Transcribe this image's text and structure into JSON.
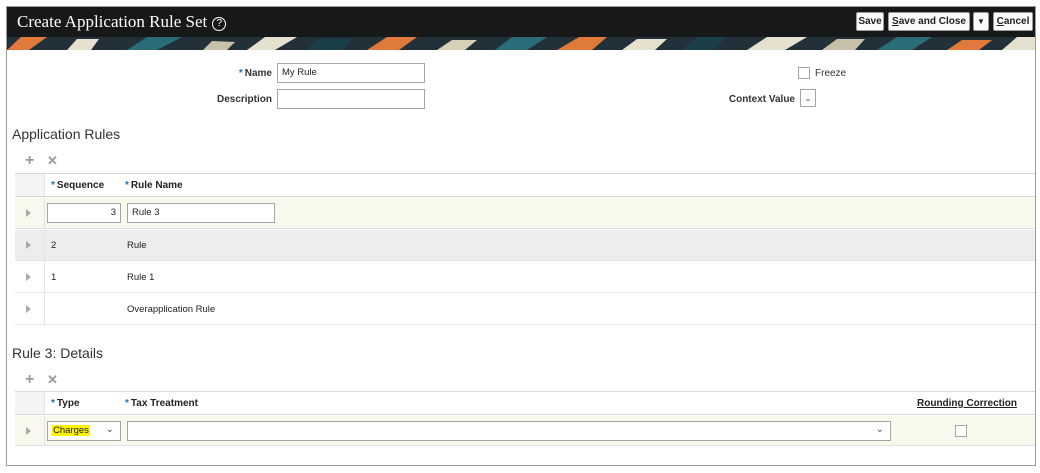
{
  "header": {
    "title": "Create Application Rule Set",
    "help_icon": "?",
    "save_label": "Save",
    "save_close_label": "Save and Close",
    "save_close_accel": "S",
    "save_close_rest": "ave and Close",
    "dropdown_icon": "▼",
    "cancel_accel": "C",
    "cancel_rest": "ancel"
  },
  "form": {
    "name_label": "Name",
    "name_value": "My Rule",
    "description_label": "Description",
    "description_value": "",
    "freeze_label": "Freeze",
    "context_value_label": "Context Value",
    "context_value_chevron": "⌄",
    "required_marker": "*"
  },
  "application_rules": {
    "title": "Application Rules",
    "add_icon": "+",
    "delete_icon": "✕",
    "columns": [
      "Sequence",
      "Rule Name"
    ],
    "rows": [
      {
        "sequence": "3",
        "rule_name": "Rule 3",
        "editing": true
      },
      {
        "sequence": "2",
        "rule_name": "Rule"
      },
      {
        "sequence": "1",
        "rule_name": "Rule 1"
      },
      {
        "sequence": "",
        "rule_name": "Overapplication Rule"
      }
    ]
  },
  "details": {
    "title": "Rule 3: Details",
    "add_icon": "+",
    "delete_icon": "✕",
    "columns": [
      "Type",
      "Tax Treatment",
      "Rounding Correction"
    ],
    "row": {
      "type": "Charges",
      "tax_treatment": "",
      "rounding_correction": false
    },
    "chevron": "⌄"
  },
  "colors": {
    "header_bg": "#17181a",
    "required": "#1f6fb5",
    "highlight": "#fff200",
    "selected_row": "#f9f8ec"
  }
}
